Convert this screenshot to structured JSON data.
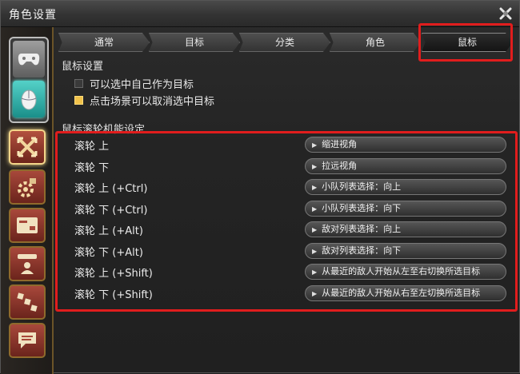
{
  "window": {
    "title": "角色设置"
  },
  "tabs": [
    {
      "label": "通常"
    },
    {
      "label": "目标"
    },
    {
      "label": "分类"
    },
    {
      "label": "角色"
    },
    {
      "label": "鼠标"
    }
  ],
  "active_tab": "鼠标",
  "mouse_settings": {
    "section_title": "鼠标设置",
    "options": [
      {
        "label": "可以选中自己作为目标",
        "checked": false
      },
      {
        "label": "点击场景可以取消选中目标",
        "checked": true
      }
    ]
  },
  "wheel_settings": {
    "section_title": "鼠标滚轮机能设定",
    "rows": [
      {
        "label": "滚轮 上",
        "value": "缩进视角"
      },
      {
        "label": "滚轮 下",
        "value": "拉远视角"
      },
      {
        "label": "滚轮 上 (+Ctrl)",
        "value": "小队列表选择：向上"
      },
      {
        "label": "滚轮 下 (+Ctrl)",
        "value": "小队列表选择：向下"
      },
      {
        "label": "滚轮 上 (+Alt)",
        "value": "敌对列表选择：向上"
      },
      {
        "label": "滚轮 下 (+Alt)",
        "value": "敌对列表选择：向下"
      },
      {
        "label": "滚轮 上 (+Shift)",
        "value": "从最近的敌人开始从左至右切换所选目标"
      },
      {
        "label": "滚轮 下 (+Shift)",
        "value": "从最近的敌人开始从右至左切换所选目标"
      }
    ]
  },
  "icons": {
    "close": "close-icon",
    "gamepad": "gamepad-icon",
    "mouse": "mouse-icon",
    "sidebar": [
      "target-crosshair-icon",
      "gear-bag-icon",
      "card-icon",
      "profile-icon",
      "dots-icon",
      "chat-icon"
    ]
  },
  "colors": {
    "highlight": "#e11d1d",
    "checked": "#f1c24b",
    "accent_border": "#6b5428"
  }
}
